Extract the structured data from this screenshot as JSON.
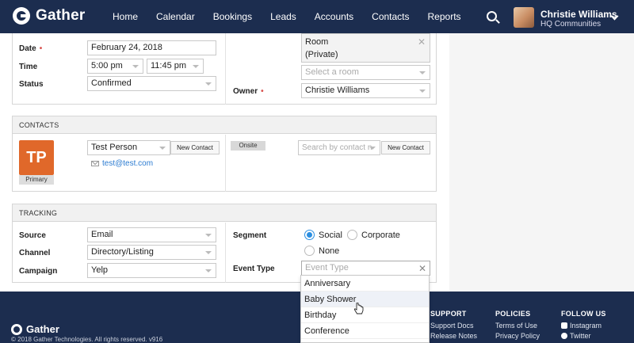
{
  "nav": {
    "logo": "Gather",
    "links": [
      "Home",
      "Calendar",
      "Bookings",
      "Leads",
      "Accounts",
      "Contacts",
      "Reports"
    ],
    "user_name": "Christie Williams",
    "user_org": "HQ Communities"
  },
  "details": {
    "date_label": "Date",
    "date_value": "February 24, 2018",
    "time_label": "Time",
    "time_start": "5:00 pm",
    "time_end": "11:45 pm",
    "status_label": "Status",
    "status_value": "Confirmed",
    "room_line1": "Room",
    "room_line2": "(Private)",
    "room_placeholder": "Select a room",
    "owner_label": "Owner",
    "owner_value": "Christie Williams",
    "required_mark": "•"
  },
  "contacts": {
    "header": "CONTACTS",
    "initials": "TP",
    "primary_label": "Primary",
    "contact_name": "Test Person",
    "new_contact_label": "New Contact",
    "email": "test@test.com",
    "onsite_label": "Onsite",
    "search_placeholder": "Search by contact n",
    "new_contact_label_2": "New Contact"
  },
  "tracking": {
    "header": "TRACKING",
    "source_label": "Source",
    "source_value": "Email",
    "channel_label": "Channel",
    "channel_value": "Directory/Listing",
    "campaign_label": "Campaign",
    "campaign_value": "Yelp",
    "segment_label": "Segment",
    "segment_options": [
      "Social",
      "Corporate",
      "None"
    ],
    "segment_selected": "Social",
    "event_type_label": "Event Type",
    "event_type_placeholder": "Event Type",
    "event_type_options": [
      "Anniversary",
      "Baby Shower",
      "Birthday",
      "Conference"
    ],
    "event_type_hovered": "Baby Shower"
  },
  "footer": {
    "logo": "Gather",
    "copyright": "© 2018 Gather Technologies. All rights reserved. v916",
    "support_head": "SUPPORT",
    "support_links": [
      "Support Docs",
      "Release Notes"
    ],
    "policies_head": "POLICIES",
    "policies_links": [
      "Terms of Use",
      "Privacy Policy"
    ],
    "follow_head": "FOLLOW US",
    "follow_links": [
      "Instagram",
      "Twitter"
    ]
  },
  "colors": {
    "nav_bg": "#1c2d4f",
    "accent_blue": "#2b8ee0",
    "badge_orange": "#e0682a",
    "required_red": "#d9534f",
    "link_blue": "#2b7bd1"
  },
  "icons": [
    "search-icon",
    "chevron-down-icon",
    "mail-icon",
    "close-icon",
    "instagram-icon",
    "twitter-icon",
    "pointer-cursor-icon"
  ]
}
